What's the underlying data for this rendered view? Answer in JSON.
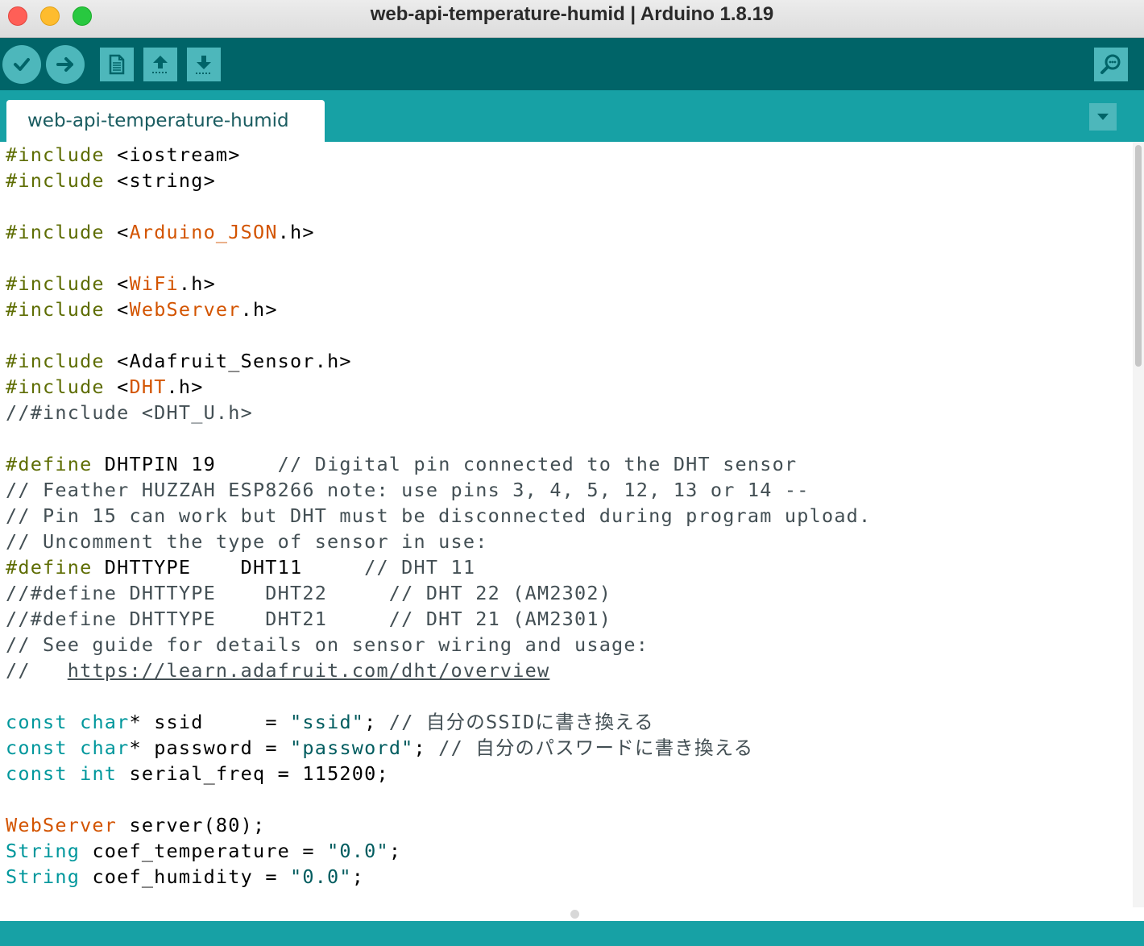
{
  "window": {
    "title": "web-api-temperature-humid | Arduino 1.8.19"
  },
  "toolbar": {
    "buttons": [
      {
        "name": "verify",
        "icon": "checkmark-icon"
      },
      {
        "name": "upload",
        "icon": "right-arrow-icon"
      },
      {
        "name": "new",
        "icon": "new-file-icon"
      },
      {
        "name": "open",
        "icon": "open-arrow-up-icon"
      },
      {
        "name": "save",
        "icon": "save-arrow-down-icon"
      },
      {
        "name": "serial-monitor",
        "icon": "magnifier-icon"
      }
    ]
  },
  "tabs": [
    {
      "label": "web-api-temperature-humid",
      "active": true
    }
  ],
  "colors": {
    "toolbar_bg": "#006468",
    "tabbar_bg": "#17a1a5",
    "button_bg": "#4db7bb",
    "preprocessor": "#5e6d03",
    "library": "#d35400",
    "type": "#00979c",
    "string": "#005c5f",
    "comment": "#434f54"
  },
  "code": [
    [
      [
        "pp",
        "#include"
      ],
      [
        "pl",
        " <iostream>"
      ]
    ],
    [
      [
        "pp",
        "#include"
      ],
      [
        "pl",
        " <string>"
      ]
    ],
    [],
    [
      [
        "pp",
        "#include"
      ],
      [
        "pl",
        " <"
      ],
      [
        "lib",
        "Arduino_JSON"
      ],
      [
        "pl",
        ".h>"
      ]
    ],
    [],
    [
      [
        "pp",
        "#include"
      ],
      [
        "pl",
        " <"
      ],
      [
        "lib",
        "WiFi"
      ],
      [
        "pl",
        ".h>"
      ]
    ],
    [
      [
        "pp",
        "#include"
      ],
      [
        "pl",
        " <"
      ],
      [
        "lib",
        "WebServer"
      ],
      [
        "pl",
        ".h>"
      ]
    ],
    [],
    [
      [
        "pp",
        "#include"
      ],
      [
        "pl",
        " <Adafruit_Sensor.h>"
      ]
    ],
    [
      [
        "pp",
        "#include"
      ],
      [
        "pl",
        " <"
      ],
      [
        "lib",
        "DHT"
      ],
      [
        "pl",
        ".h>"
      ]
    ],
    [
      [
        "cm",
        "//#include <DHT_U.h>"
      ]
    ],
    [],
    [
      [
        "pp",
        "#define"
      ],
      [
        "pl",
        " DHTPIN 19     "
      ],
      [
        "cm",
        "// Digital pin connected to the DHT sensor"
      ]
    ],
    [
      [
        "cm",
        "// Feather HUZZAH ESP8266 note: use pins 3, 4, 5, 12, 13 or 14 --"
      ]
    ],
    [
      [
        "cm",
        "// Pin 15 can work but DHT must be disconnected during program upload."
      ]
    ],
    [
      [
        "cm",
        "// Uncomment the type of sensor in use:"
      ]
    ],
    [
      [
        "pp",
        "#define"
      ],
      [
        "pl",
        " DHTTYPE    DHT11     "
      ],
      [
        "cm",
        "// DHT 11"
      ]
    ],
    [
      [
        "cm",
        "//#define DHTTYPE    DHT22     // DHT 22 (AM2302)"
      ]
    ],
    [
      [
        "cm",
        "//#define DHTTYPE    DHT21     // DHT 21 (AM2301)"
      ]
    ],
    [
      [
        "cm",
        "// See guide for details on sensor wiring and usage:"
      ]
    ],
    [
      [
        "cm",
        "//   "
      ],
      [
        "url",
        "https://learn.adafruit.com/dht/overview"
      ]
    ],
    [],
    [
      [
        "ty",
        "const"
      ],
      [
        "pl",
        " "
      ],
      [
        "ty",
        "char"
      ],
      [
        "pl",
        "* ssid     = "
      ],
      [
        "str",
        "\"ssid\""
      ],
      [
        "pl",
        "; "
      ],
      [
        "cm",
        "// 自分のSSIDに書き換える"
      ]
    ],
    [
      [
        "ty",
        "const"
      ],
      [
        "pl",
        " "
      ],
      [
        "ty",
        "char"
      ],
      [
        "pl",
        "* password = "
      ],
      [
        "str",
        "\"password\""
      ],
      [
        "pl",
        "; "
      ],
      [
        "cm",
        "// 自分のパスワードに書き換える"
      ]
    ],
    [
      [
        "ty",
        "const"
      ],
      [
        "pl",
        " "
      ],
      [
        "ty",
        "int"
      ],
      [
        "pl",
        " serial_freq = 115200;"
      ]
    ],
    [],
    [
      [
        "lib",
        "WebServer"
      ],
      [
        "pl",
        " server(80);"
      ]
    ],
    [
      [
        "ty",
        "String"
      ],
      [
        "pl",
        " coef_temperature = "
      ],
      [
        "str",
        "\"0.0\""
      ],
      [
        "pl",
        ";"
      ]
    ],
    [
      [
        "ty",
        "String"
      ],
      [
        "pl",
        " coef_humidity = "
      ],
      [
        "str",
        "\"0.0\""
      ],
      [
        "pl",
        ";"
      ]
    ]
  ]
}
